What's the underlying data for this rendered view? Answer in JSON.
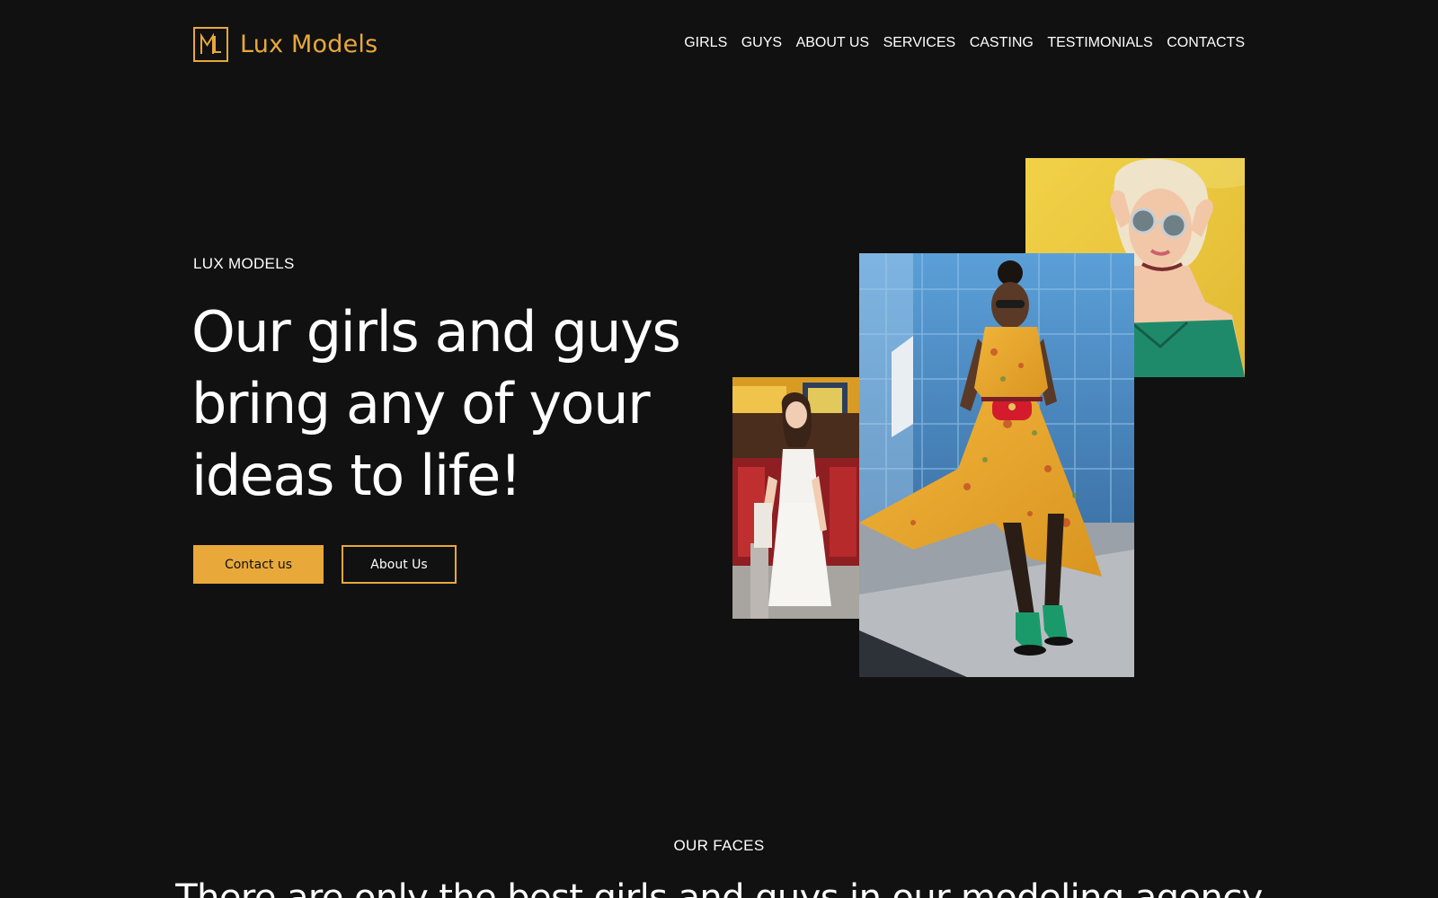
{
  "brand": {
    "name": "Lux Models",
    "logo_icon": "lm-monogram-icon",
    "accent_color": "#e8a83a",
    "background_color": "#111112"
  },
  "nav": {
    "items": [
      {
        "label": "GIRLS"
      },
      {
        "label": "GUYS"
      },
      {
        "label": "ABOUT US"
      },
      {
        "label": "SERVICES"
      },
      {
        "label": "CASTING"
      },
      {
        "label": "TESTIMONIALS"
      },
      {
        "label": "CONTACTS"
      }
    ]
  },
  "hero": {
    "eyebrow": "LUX MODELS",
    "headline": "Our girls and guys bring any of your ideas to life!",
    "primary_button": "Contact us",
    "secondary_button": "About Us"
  },
  "gallery": {
    "images": [
      {
        "name": "model-yellow-wall-photo"
      },
      {
        "name": "model-street-white-dress-photo"
      },
      {
        "name": "model-yellow-floral-dress-photo"
      }
    ]
  },
  "faces_section": {
    "eyebrow": "OUR FACES",
    "title": "There are only the best girls and guys in our modeling agency"
  }
}
